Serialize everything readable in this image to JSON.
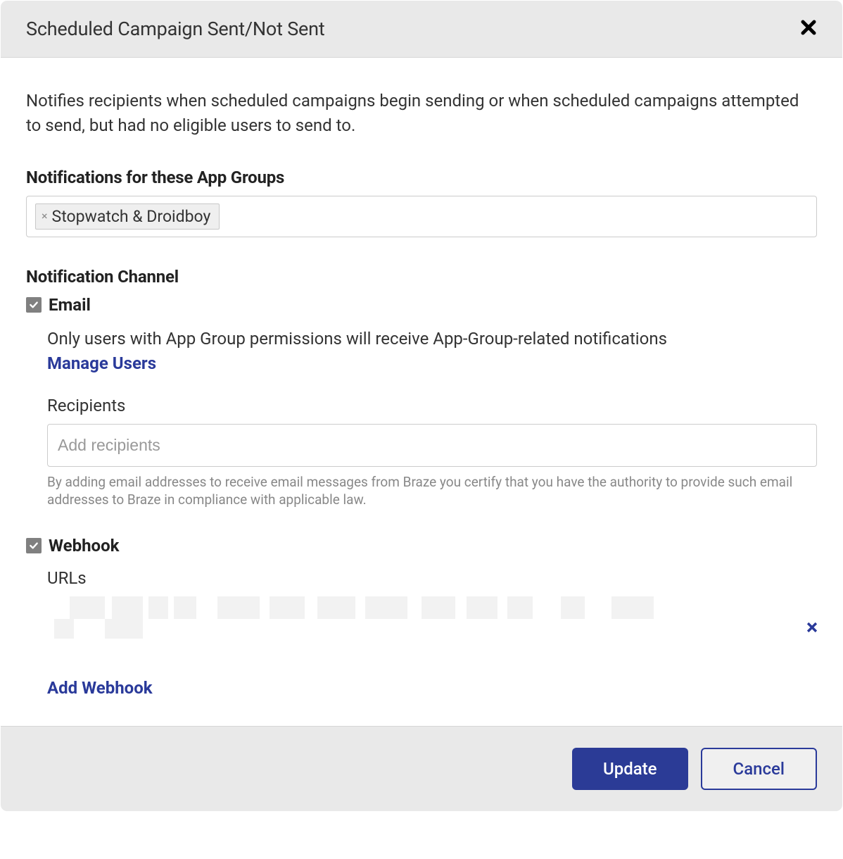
{
  "modal": {
    "title": "Scheduled Campaign Sent/Not Sent",
    "description": "Notifies recipients when scheduled campaigns begin sending or when scheduled campaigns attempted to send, but had no eligible users to send to."
  },
  "appGroups": {
    "label": "Notifications for these App Groups",
    "tags": [
      {
        "label": "Stopwatch & Droidboy"
      }
    ]
  },
  "channel": {
    "label": "Notification Channel",
    "email": {
      "label": "Email",
      "checked": true,
      "helper": "Only users with App Group permissions will receive App-Group-related notifications",
      "manageLink": "Manage Users",
      "recipientsLabel": "Recipients",
      "recipientsPlaceholder": "Add recipients",
      "finePrint": "By adding email addresses to receive email messages from Braze you certify that you have the authority to provide such email addresses to Braze in compliance with applicable law."
    },
    "webhook": {
      "label": "Webhook",
      "checked": true,
      "urlsLabel": "URLs",
      "addWebhookLabel": "Add Webhook"
    }
  },
  "footer": {
    "update": "Update",
    "cancel": "Cancel"
  }
}
